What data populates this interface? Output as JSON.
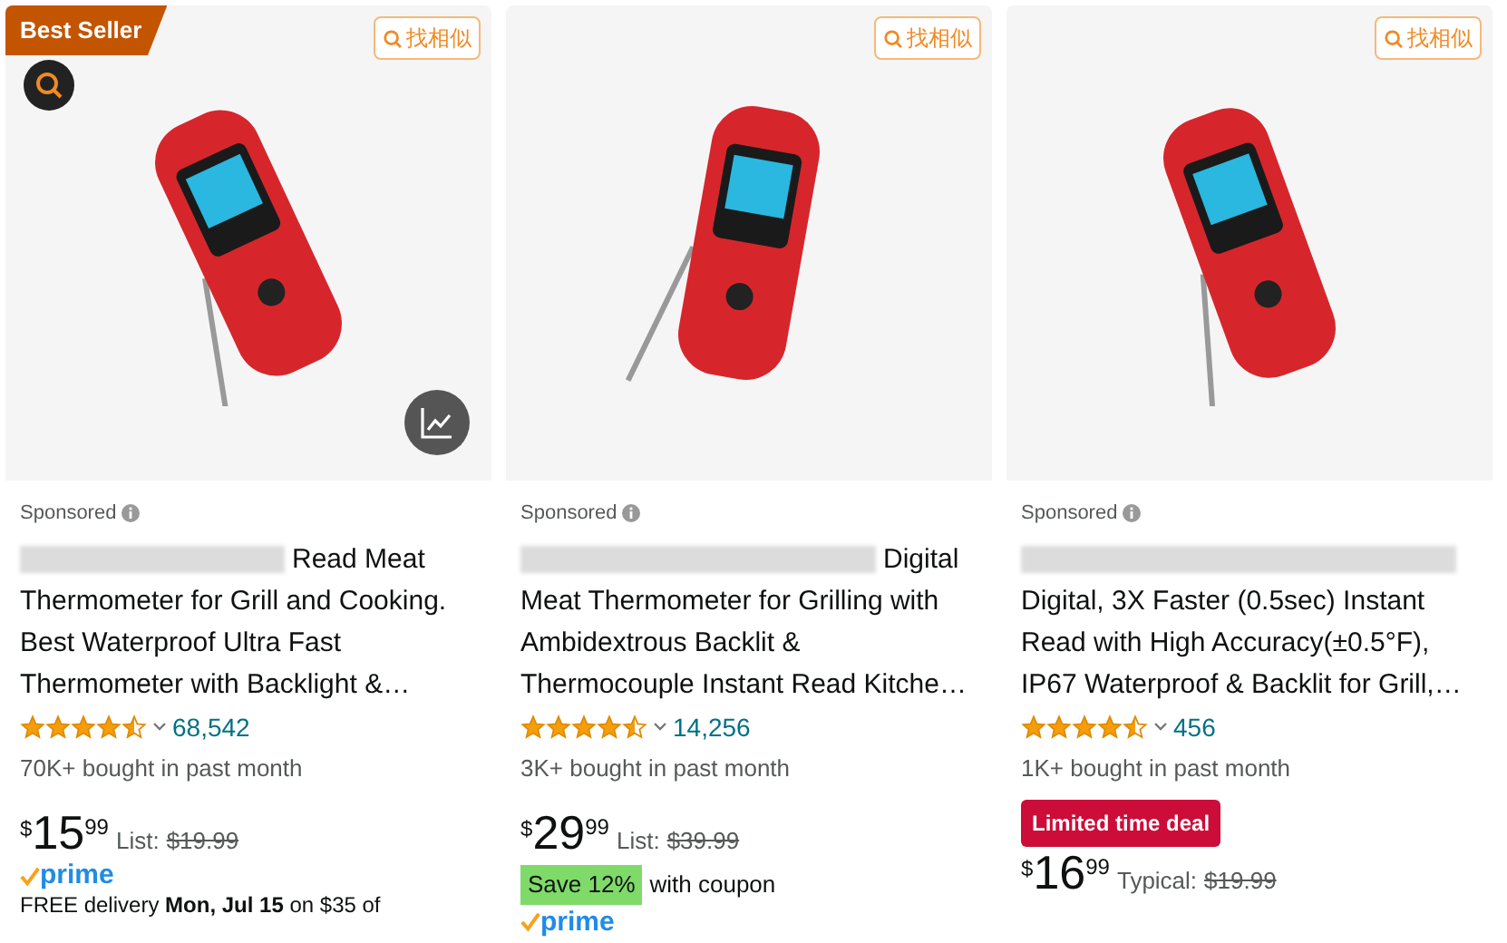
{
  "products": [
    {
      "badge": "Best Seller",
      "similar_button": "找相似",
      "sponsored": "Sponsored",
      "title": "Read Meat Thermometer for Grill and Cooking. Best Waterproof Ultra Fast Thermometer with Backlight &…",
      "stars": 4.5,
      "reviews": "68,542",
      "bought": "70K+ bought in past month",
      "price": {
        "symbol": "$",
        "whole": "15",
        "fraction": "99"
      },
      "list_label": "List:",
      "list_price": "$19.99",
      "prime": "prime",
      "delivery": "FREE delivery **Mon, Jul 15** on $35 of"
    },
    {
      "similar_button": "找相似",
      "sponsored": "Sponsored",
      "title": "Digital Meat Thermometer for Grilling with Ambidextrous Backlit & Thermocouple Instant Read Kitche…",
      "stars": 4.5,
      "reviews": "14,256",
      "bought": "3K+ bought in past month",
      "price": {
        "symbol": "$",
        "whole": "29",
        "fraction": "99"
      },
      "list_label": "List:",
      "list_price": "$39.99",
      "coupon": {
        "save": "Save 12%",
        "text": "with coupon"
      },
      "prime": "prime"
    },
    {
      "similar_button": "找相似",
      "sponsored": "Sponsored",
      "title": "Digital, 3X Faster (0.5sec) Instant Read with High Accuracy(±0.5°F), IP67 Waterproof & Backlit for Grill,…",
      "stars": 4.5,
      "reviews": "456",
      "bought": "1K+ bought in past month",
      "deal": "Limited time deal",
      "price": {
        "symbol": "$",
        "whole": "16",
        "fraction": "99"
      },
      "list_label": "Typical:",
      "list_price": "$19.99"
    }
  ]
}
